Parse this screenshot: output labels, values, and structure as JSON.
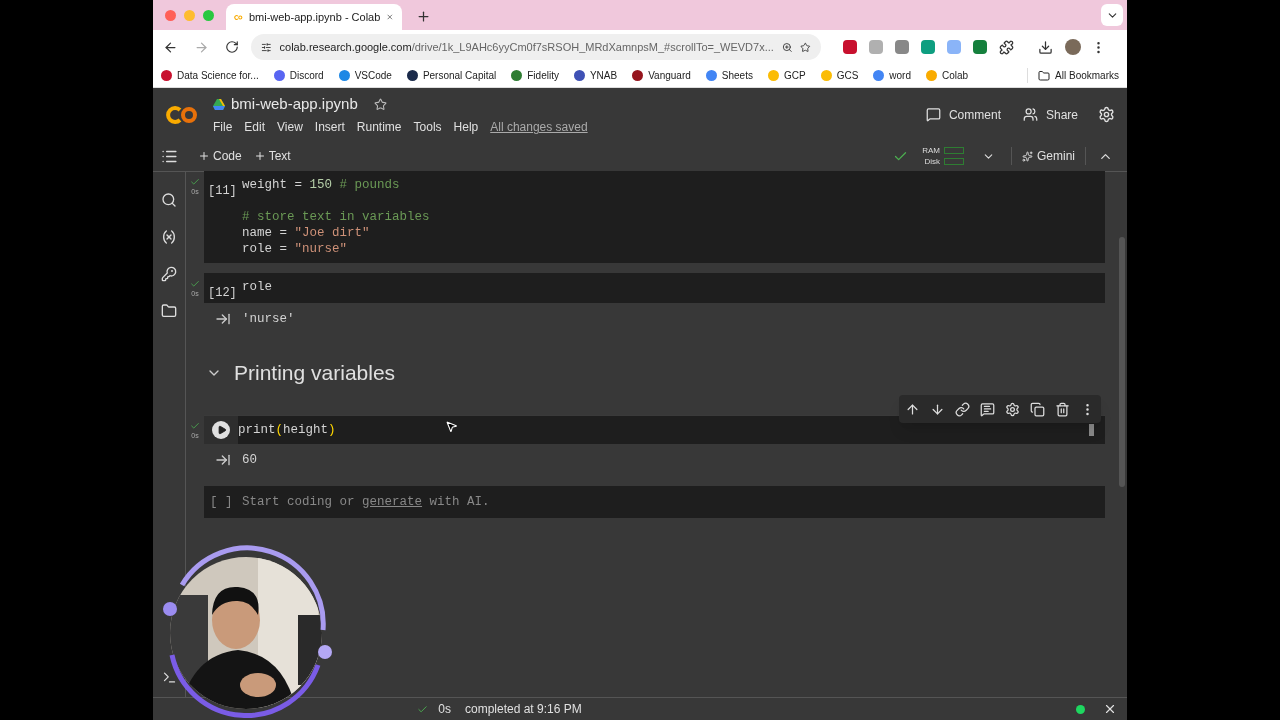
{
  "browser": {
    "tab": {
      "title": "bmi-web-app.ipynb - Colab"
    },
    "url": {
      "host": "colab.research.google.com",
      "path": "/drive/1k_L9AHc6yyCm0f7sRSOH_MRdXamnpsM_#scrollTo=_WEVD7x..."
    },
    "extensions": [
      {
        "color": "#c8102e"
      },
      {
        "color": "#b0b0b0"
      },
      {
        "color": "#888888"
      },
      {
        "color": "#0e9e80"
      },
      {
        "color": "#8ab4f8"
      },
      {
        "color": "#15803d"
      }
    ],
    "bookmarks": [
      {
        "label": "Data Science for...",
        "color": "#c8102e"
      },
      {
        "label": "Discord",
        "color": "#5865f2"
      },
      {
        "label": "VSCode",
        "color": "#1e88e5"
      },
      {
        "label": "Personal Capital",
        "color": "#1a2a4a"
      },
      {
        "label": "Fidelity",
        "color": "#2e7d32"
      },
      {
        "label": "YNAB",
        "color": "#3f51b5"
      },
      {
        "label": "Vanguard",
        "color": "#96151d"
      },
      {
        "label": "Sheets",
        "color": "#4285f4"
      },
      {
        "label": "GCP",
        "color": "#fbbc04"
      },
      {
        "label": "GCS",
        "color": "#fbbc04"
      },
      {
        "label": "word",
        "color": "#4285f4"
      },
      {
        "label": "Colab",
        "color": "#f9ab00"
      }
    ],
    "all_bookmarks": "All Bookmarks"
  },
  "notebook": {
    "title": "bmi-web-app.ipynb",
    "menu": [
      "File",
      "Edit",
      "View",
      "Insert",
      "Runtime",
      "Tools",
      "Help"
    ],
    "save_status": "All changes saved",
    "comment": "Comment",
    "share": "Share",
    "add_buttons": [
      "Code",
      "Text"
    ],
    "ram": "RAM",
    "disk": "Disk",
    "gemini": "Gemini"
  },
  "cells": [
    {
      "kind": "code",
      "label": "[11]",
      "time": "0s",
      "focused": false,
      "lines": [
        {
          "kind": "code",
          "tokens": [
            {
              "text": "weight = ",
              "kind": "plain"
            },
            {
              "text": "150",
              "kind": "number"
            },
            {
              "text": " # pounds",
              "kind": "comment"
            }
          ]
        },
        {
          "kind": "blank"
        },
        {
          "kind": "code",
          "tokens": [
            {
              "text": "# store text in variables",
              "kind": "comment"
            }
          ]
        },
        {
          "kind": "code",
          "tokens": [
            {
              "text": "name = ",
              "kind": "plain"
            },
            {
              "text": "\"Joe dirt\"",
              "kind": "string"
            }
          ]
        },
        {
          "kind": "code",
          "tokens": [
            {
              "text": "role = ",
              "kind": "plain"
            },
            {
              "text": "\"nurse\"",
              "kind": "string"
            }
          ]
        }
      ]
    },
    {
      "kind": "code",
      "label": "[12]",
      "time": "0s",
      "focused": false,
      "lines": [
        {
          "kind": "code",
          "tokens": [
            {
              "text": "role",
              "kind": "plain"
            }
          ]
        }
      ]
    },
    {
      "kind": "output",
      "text": "'nurse'"
    },
    {
      "kind": "heading",
      "text": "Printing variables",
      "expanded": true
    },
    {
      "kind": "code",
      "time": "0s",
      "focused": true,
      "lines": [
        {
          "kind": "code",
          "tokens": [
            {
              "text": "print",
              "kind": "plain"
            },
            {
              "text": "(",
              "kind": "bracket"
            },
            {
              "text": "height",
              "kind": "plain"
            },
            {
              "text": ")",
              "kind": "bracket"
            }
          ]
        }
      ]
    },
    {
      "kind": "output",
      "text": "60"
    },
    {
      "kind": "empty",
      "label": "[ ]",
      "hint_before": "Start coding or ",
      "hint_link": "generate",
      "hint_after": " with AI."
    }
  ],
  "status_bar": {
    "time": "0s",
    "message": "completed at 9:16 PM"
  }
}
